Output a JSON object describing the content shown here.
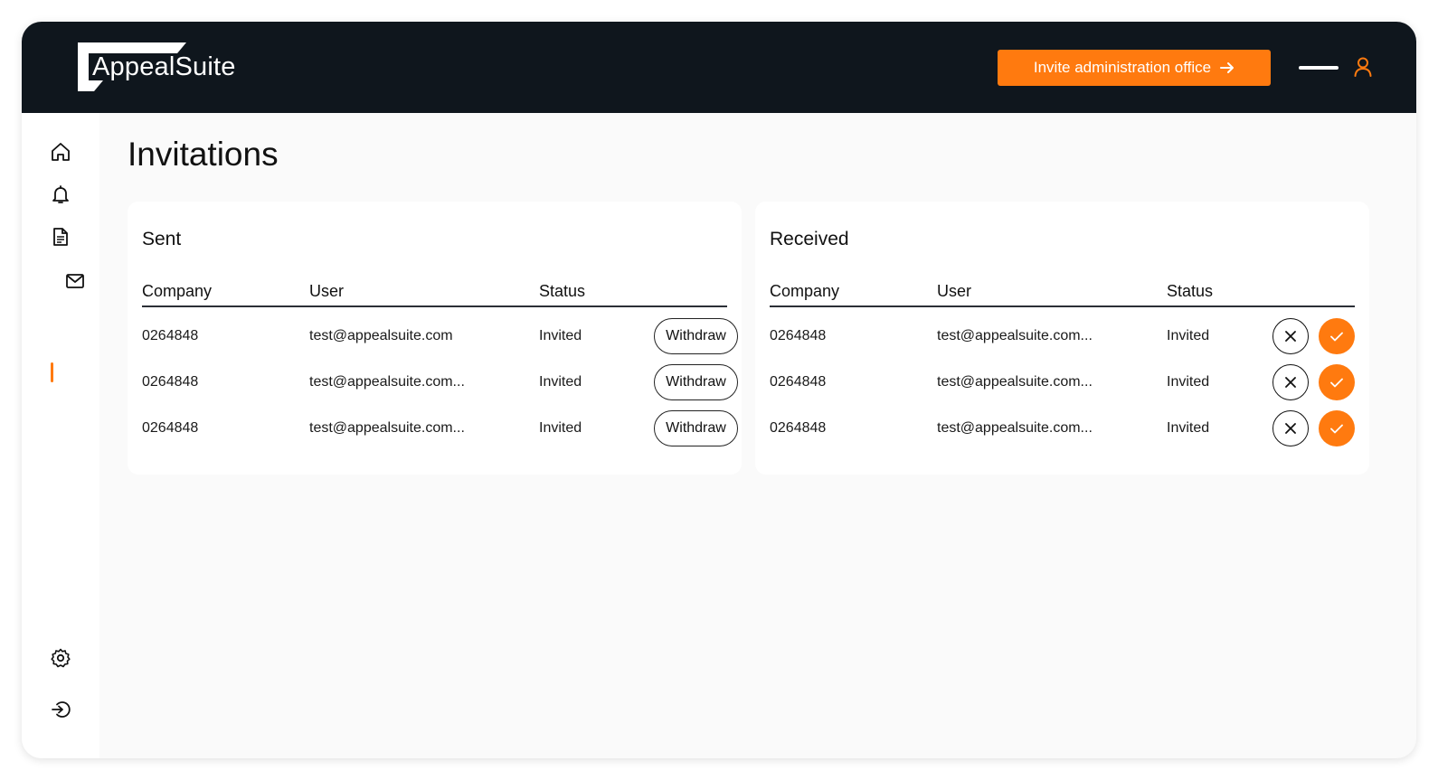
{
  "app": {
    "logo_text": "AppealSuite",
    "brand_color": "#ff7a0f",
    "header_color": "#0f161d"
  },
  "header": {
    "invite_button_label": "Invite administration office",
    "invite_icon": "arrow-right-icon",
    "menu_icon": "menu-bar-icon",
    "user_icon": "user-icon"
  },
  "sidebar": {
    "items": [
      {
        "icon": "home-icon",
        "active": false
      },
      {
        "icon": "bell-icon",
        "active": false
      },
      {
        "icon": "document-icon",
        "active": false
      },
      {
        "icon": "mail-icon",
        "active": true
      }
    ],
    "bottom": [
      {
        "icon": "gear-icon"
      },
      {
        "icon": "logout-icon"
      }
    ]
  },
  "page": {
    "title": "Invitations"
  },
  "sent": {
    "title": "Sent",
    "columns": [
      "Company",
      "User",
      "Status"
    ],
    "rows": [
      {
        "company": "0264848",
        "user": "test@appealsuite.com",
        "status": "Invited",
        "action": "Withdraw"
      },
      {
        "company": "0264848",
        "user": "test@appealsuite.com...",
        "status": "Invited",
        "action": "Withdraw"
      },
      {
        "company": "0264848",
        "user": "test@appealsuite.com...",
        "status": "Invited",
        "action": "Withdraw"
      }
    ]
  },
  "received": {
    "title": "Received",
    "columns": [
      "Company",
      "User",
      "Status"
    ],
    "rows": [
      {
        "company": "0264848",
        "user": "test@appealsuite.com...",
        "status": "Invited"
      },
      {
        "company": "0264848",
        "user": "test@appealsuite.com...",
        "status": "Invited"
      },
      {
        "company": "0264848",
        "user": "test@appealsuite.com...",
        "status": "Invited"
      }
    ]
  }
}
